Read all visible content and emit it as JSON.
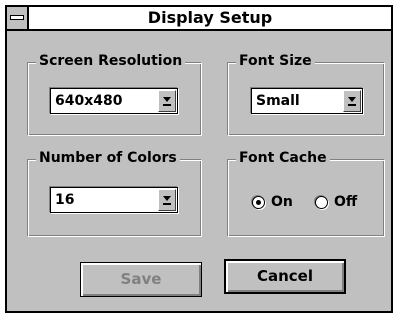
{
  "window": {
    "title": "Display Setup"
  },
  "screen_resolution": {
    "label": "Screen Resolution",
    "value": "640x480"
  },
  "font_size": {
    "label": "Font Size",
    "value": "Small"
  },
  "number_of_colors": {
    "label": "Number of Colors",
    "value": "16"
  },
  "font_cache": {
    "label": "Font Cache",
    "options": [
      {
        "label": "On",
        "checked": true
      },
      {
        "label": "Off",
        "checked": false
      }
    ]
  },
  "buttons": {
    "save": "Save",
    "cancel": "Cancel",
    "save_enabled": false
  },
  "icons": {
    "system_menu": "system-menu-icon",
    "dropdown": "dropdown-arrow-icon"
  }
}
